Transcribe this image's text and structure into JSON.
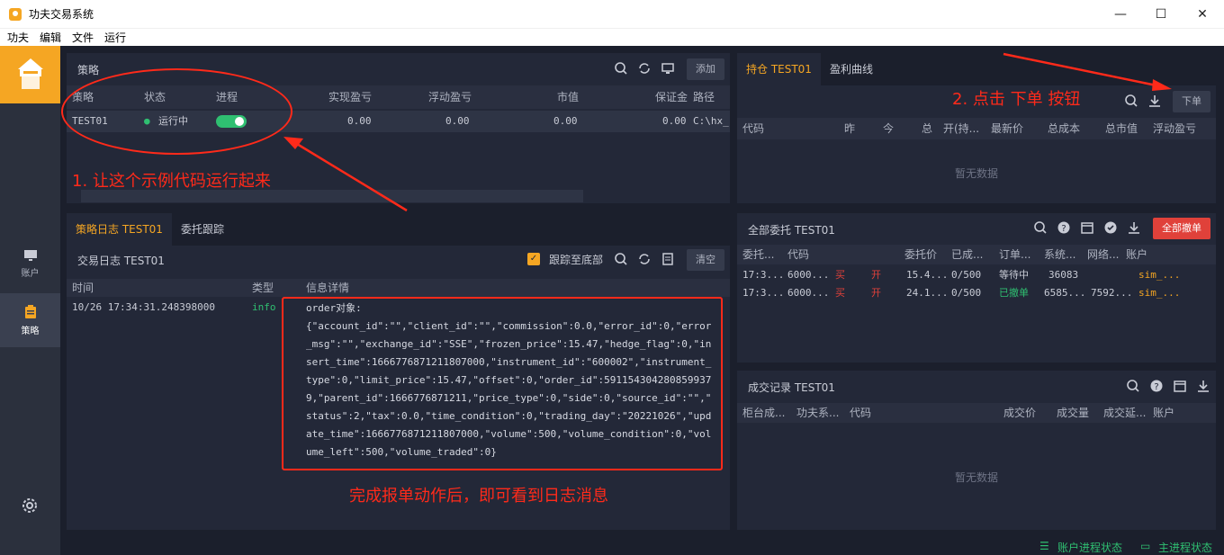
{
  "window": {
    "title": "功夫交易系统",
    "minimize": "—",
    "maximize": "☐",
    "close": "✕"
  },
  "menu": [
    "功夫",
    "编辑",
    "文件",
    "运行"
  ],
  "sidebar": {
    "items": [
      {
        "label": "账户",
        "icon": "monitor-icon"
      },
      {
        "label": "策略",
        "icon": "clipboard-icon"
      }
    ],
    "settings_icon": "gear-icon"
  },
  "strategy": {
    "title": "策略",
    "add_button": "添加",
    "columns": [
      "策略",
      "状态",
      "进程",
      "实现盈亏",
      "浮动盈亏",
      "市值",
      "保证金",
      "路径"
    ],
    "rows": [
      {
        "name": "TEST01",
        "status": "运行中",
        "realized": "0.00",
        "floating": "0.00",
        "market_value": "0.00",
        "margin": "0.00",
        "path": "C:\\hx_"
      }
    ]
  },
  "log": {
    "tabs": [
      "策略日志 TEST01",
      "委托跟踪"
    ],
    "subtitle": "交易日志 TEST01",
    "follow_bottom": "跟踪至底部",
    "clear_button": "清空",
    "columns": [
      "时间",
      "类型",
      "信息详情"
    ],
    "entry": {
      "time": "10/26 17:34:31.248398000",
      "type": "info",
      "lines": [
        "order对象:",
        "{\"account_id\":\"\",\"client_id\":\"\",\"commission\":0.0,\"error_id\":0,\"error",
        "_msg\":\"\",\"exchange_id\":\"SSE\",\"frozen_price\":15.47,\"hedge_flag\":0,\"in",
        "sert_time\":1666776871211807000,\"instrument_id\":\"600002\",\"instrument_",
        "type\":0,\"limit_price\":15.47,\"offset\":0,\"order_id\":591154304280859937",
        "9,\"parent_id\":1666776871211,\"price_type\":0,\"side\":0,\"source_id\":\"\",\"",
        "status\":2,\"tax\":0.0,\"time_condition\":0,\"trading_day\":\"20221026\",\"upd",
        "ate_time\":1666776871211807000,\"volume\":500,\"volume_condition\":0,\"vol",
        "ume_left\":500,\"volume_traded\":0}"
      ]
    }
  },
  "positions": {
    "tabs": [
      "持仓 TEST01",
      "盈利曲线"
    ],
    "order_button": "下单",
    "columns": [
      "代码",
      "昨",
      "今",
      "总",
      "开(持...",
      "最新价",
      "总成本",
      "总市值",
      "浮动盈亏"
    ],
    "empty": "暂无数据"
  },
  "orders": {
    "title": "全部委托 TEST01",
    "cancel_all": "全部撤单",
    "columns": [
      "委托...",
      "代码",
      "委托价",
      "已成...",
      "订单...",
      "系统...",
      "网络...",
      "账户"
    ],
    "rows": [
      {
        "time": "17:3...",
        "code": "6000...",
        "side": "买",
        "offset": "开",
        "price": "15.4...",
        "filled": "0/500",
        "status": "等待中",
        "sys": "36083",
        "net": "",
        "account": "sim_..."
      },
      {
        "time": "17:3...",
        "code": "6000...",
        "side": "买",
        "offset": "开",
        "price": "24.1...",
        "filled": "0/500",
        "status": "已撤单",
        "sys": "6585...",
        "net": "7592...",
        "account": "sim_..."
      }
    ]
  },
  "trades": {
    "title": "成交记录 TEST01",
    "columns": [
      "柜台成...",
      "功夫系...",
      "代码",
      "成交价",
      "成交量",
      "成交延...",
      "账户"
    ],
    "empty": "暂无数据"
  },
  "annotations": {
    "step1": "1. 让这个示例代码运行起来",
    "step2": "2. 点击 下单 按钮",
    "step3": "完成报单动作后，即可看到日志消息"
  },
  "statusbar": {
    "account_process": "账户进程状态",
    "main_process": "主进程状态"
  },
  "colors": {
    "accent": "#f5a623",
    "running": "#2fbf71",
    "buy": "#e0413a",
    "annotation": "#ff2a1a"
  }
}
